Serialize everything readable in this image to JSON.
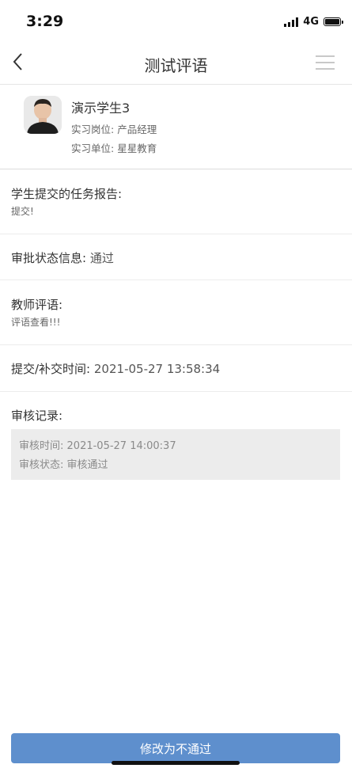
{
  "status_bar": {
    "time": "3:29",
    "network": "4G"
  },
  "nav": {
    "title": "测试评语",
    "back_icon": "chevron-left-icon",
    "menu_icon": "hamburger-menu-icon"
  },
  "profile": {
    "name": "演示学生3",
    "position_label": "实习岗位:",
    "position_value": "产品经理",
    "company_label": "实习单位:",
    "company_value": "星星教育"
  },
  "report": {
    "title": "学生提交的任务报告:",
    "content": "提交!"
  },
  "approval": {
    "label": "审批状态信息:",
    "value": "通过"
  },
  "teacher_comment": {
    "title": "教师评语:",
    "content": "评语查看!!!"
  },
  "submit_time": {
    "label": "提交/补交时间:",
    "value": "2021-05-27 13:58:34"
  },
  "audit_record": {
    "title": "审核记录:",
    "time_label": "审核时间:",
    "time_value": "2021-05-27 14:00:37",
    "status_label": "审核状态:",
    "status_value": "审核通过"
  },
  "action": {
    "button_label": "修改为不通过"
  },
  "colors": {
    "primary_button": "#5e8fcd",
    "record_bg": "#ececec"
  }
}
